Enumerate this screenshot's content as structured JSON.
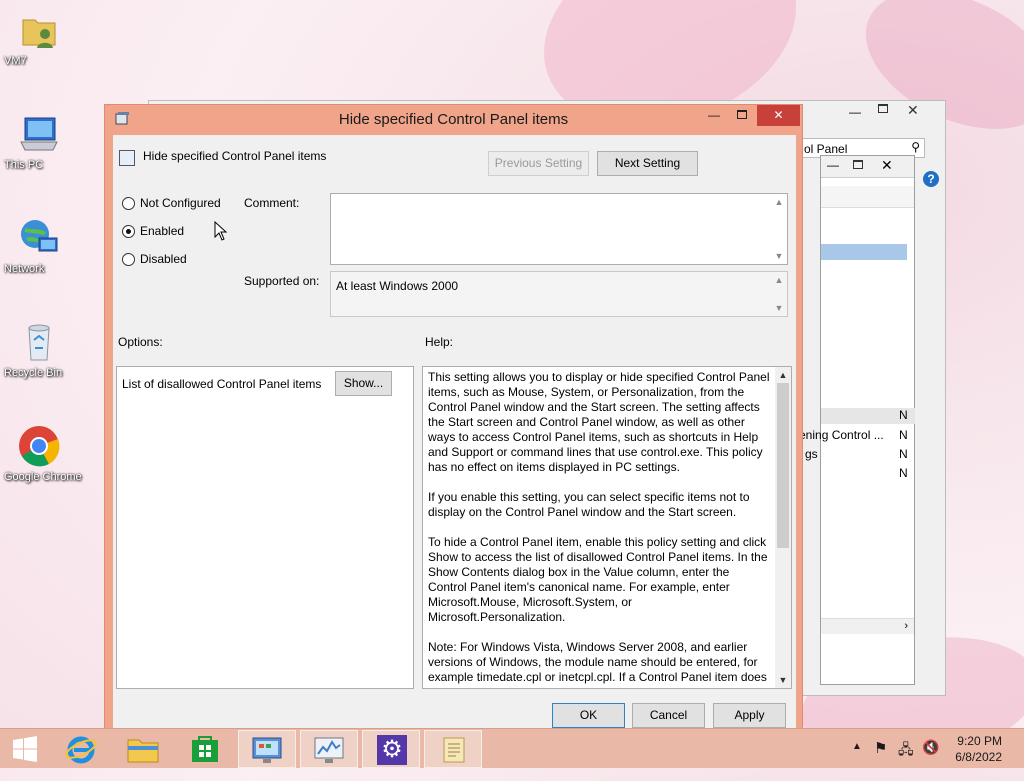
{
  "desktop": {
    "icons": [
      {
        "label": "VM7",
        "icon": "user-folder-icon"
      },
      {
        "label": "This PC",
        "icon": "computer-icon"
      },
      {
        "label": "Network",
        "icon": "network-icon"
      },
      {
        "label": "Recycle Bin",
        "icon": "recycle-bin-icon"
      },
      {
        "label": "Google Chrome",
        "icon": "chrome-icon"
      }
    ]
  },
  "background_window": {
    "search_text": "ol Panel",
    "rows": [
      {
        "text": "",
        "col": "N"
      },
      {
        "text": "ening Control ...",
        "col": "N"
      },
      {
        "text": "gs",
        "col": "N"
      },
      {
        "text": "",
        "col": "N"
      }
    ]
  },
  "dialog": {
    "title": "Hide specified Control Panel items",
    "header_title": "Hide specified Control Panel items",
    "prev_button": "Previous Setting",
    "next_button": "Next Setting",
    "radios": [
      {
        "label": "Not Configured",
        "checked": false
      },
      {
        "label": "Enabled",
        "checked": true
      },
      {
        "label": "Disabled",
        "checked": false
      }
    ],
    "comment_label": "Comment:",
    "comment_value": "",
    "supported_label": "Supported on:",
    "supported_value": "At least Windows 2000",
    "options_label": "Options:",
    "help_label": "Help:",
    "option_item_label": "List of disallowed Control Panel items",
    "show_button": "Show...",
    "help_paragraphs": [
      "This setting allows you to display or hide specified Control Panel items, such as Mouse, System, or Personalization, from the Control Panel window and the Start screen. The setting affects the Start screen and Control Panel window, as well as other ways to access Control Panel items, such as shortcuts in Help and Support or command lines that use control.exe. This policy has no effect on items displayed in PC settings.",
      "If you enable this setting, you can select specific items not to display on the Control Panel window and the Start screen.",
      "To hide a Control Panel item, enable this policy setting and click Show to access the list of disallowed Control Panel items. In the Show Contents dialog box in the Value column, enter the Control Panel item's canonical name. For example, enter Microsoft.Mouse, Microsoft.System, or Microsoft.Personalization.",
      "Note: For Windows Vista, Windows Server 2008, and earlier versions of Windows, the module name should be entered, for example timedate.cpl or inetcpl.cpl. If a Control Panel item does"
    ],
    "ok_button": "OK",
    "cancel_button": "Cancel",
    "apply_button": "Apply"
  },
  "taskbar": {
    "time": "9:20 PM",
    "date": "6/8/2022"
  }
}
